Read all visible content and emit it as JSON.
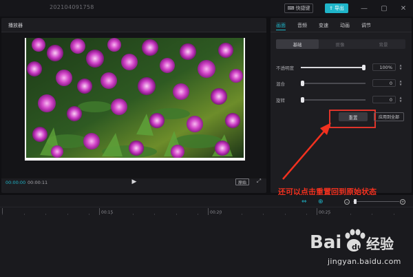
{
  "titlebar": {
    "project_name": "202104091758",
    "shortcut_label": "快捷键",
    "export_label": "导出"
  },
  "player": {
    "title": "播放器",
    "time_current": "00:00:00",
    "time_total": "00:00:11",
    "ratio_label": "原始"
  },
  "props": {
    "tabs": [
      "画面",
      "音频",
      "变速",
      "动画",
      "调节"
    ],
    "subtabs": [
      "基础",
      "抠像",
      "背景"
    ],
    "opacity_label": "不透明度",
    "opacity_value": "100%",
    "opacity_fraction": 1.0,
    "blend_label": "混合",
    "blend_value": "0",
    "blend_fraction": 0.0,
    "rotate_label": "旋转",
    "rotate_value": "0",
    "rotate_fraction": 0.0,
    "reset_label": "重置",
    "apply_all_label": "应用到全部"
  },
  "annotation": {
    "text": "还可以点击重置回到原始状态",
    "color": "#f2311f"
  },
  "timeline": {
    "ticks": [
      "00:15",
      "00:20",
      "00:25"
    ]
  },
  "watermark": {
    "logo_text": "Bai du 经验",
    "url": "jingyan.baidu.com"
  },
  "colors": {
    "accent": "#1fb5c9",
    "highlight": "#e0342a"
  }
}
